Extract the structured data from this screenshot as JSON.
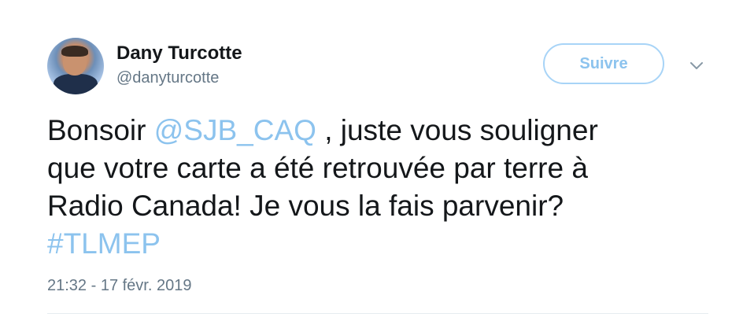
{
  "author": {
    "display_name": "Dany Turcotte",
    "handle": "@danyturcotte",
    "avatar_icon": "profile-photo"
  },
  "actions": {
    "follow_label": "Suivre",
    "more_icon": "chevron-down-icon"
  },
  "tweet": {
    "line1_before": "Bonsoir ",
    "mention": "@SJB_CAQ",
    "line1_after": " , juste vous souligner",
    "line2": "que votre carte a été retrouvée par terre à",
    "line3": "Radio Canada! Je vous la fais parvenir?",
    "hashtag": "#TLMEP",
    "timestamp": "21:32 - 17 févr. 2019"
  },
  "colors": {
    "link": "#8cc3ee",
    "follow_border": "#a8d4f7",
    "secondary_text": "#657786",
    "primary_text": "#14171a"
  }
}
